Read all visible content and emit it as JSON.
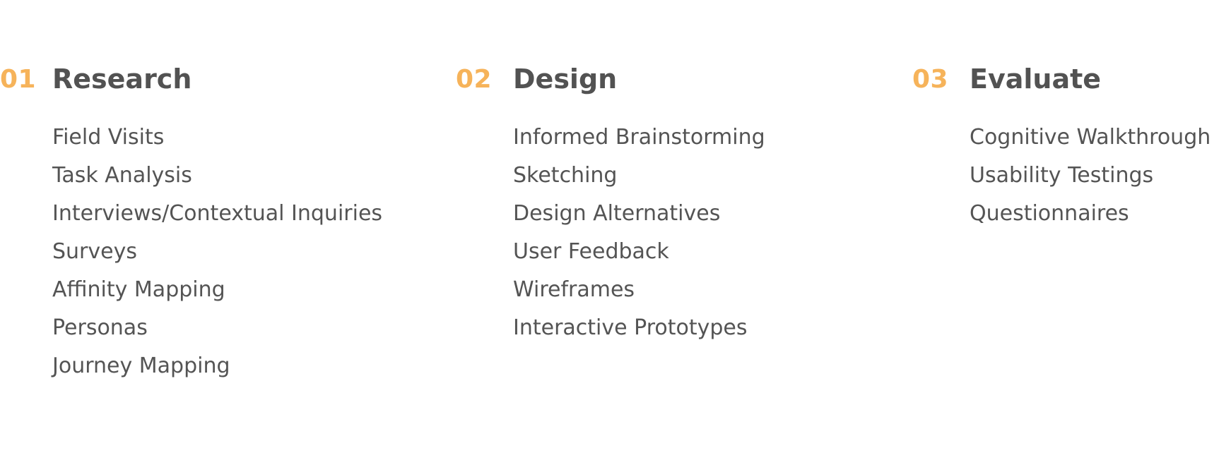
{
  "accent_color": "#f6b35a",
  "text_color": "#545454",
  "columns": [
    {
      "number": "01",
      "title": "Research",
      "items": [
        "Field Visits",
        "Task Analysis",
        "Interviews/Contextual Inquiries",
        "Surveys",
        "Affinity Mapping",
        "Personas",
        "Journey Mapping"
      ]
    },
    {
      "number": "02",
      "title": "Design",
      "items": [
        "Informed Brainstorming",
        "Sketching",
        "Design Alternatives",
        "User Feedback",
        "Wireframes",
        "Interactive Prototypes"
      ]
    },
    {
      "number": "03",
      "title": "Evaluate",
      "items": [
        "Cognitive Walkthrough",
        "Usability Testings",
        "Questionnaires"
      ]
    }
  ]
}
